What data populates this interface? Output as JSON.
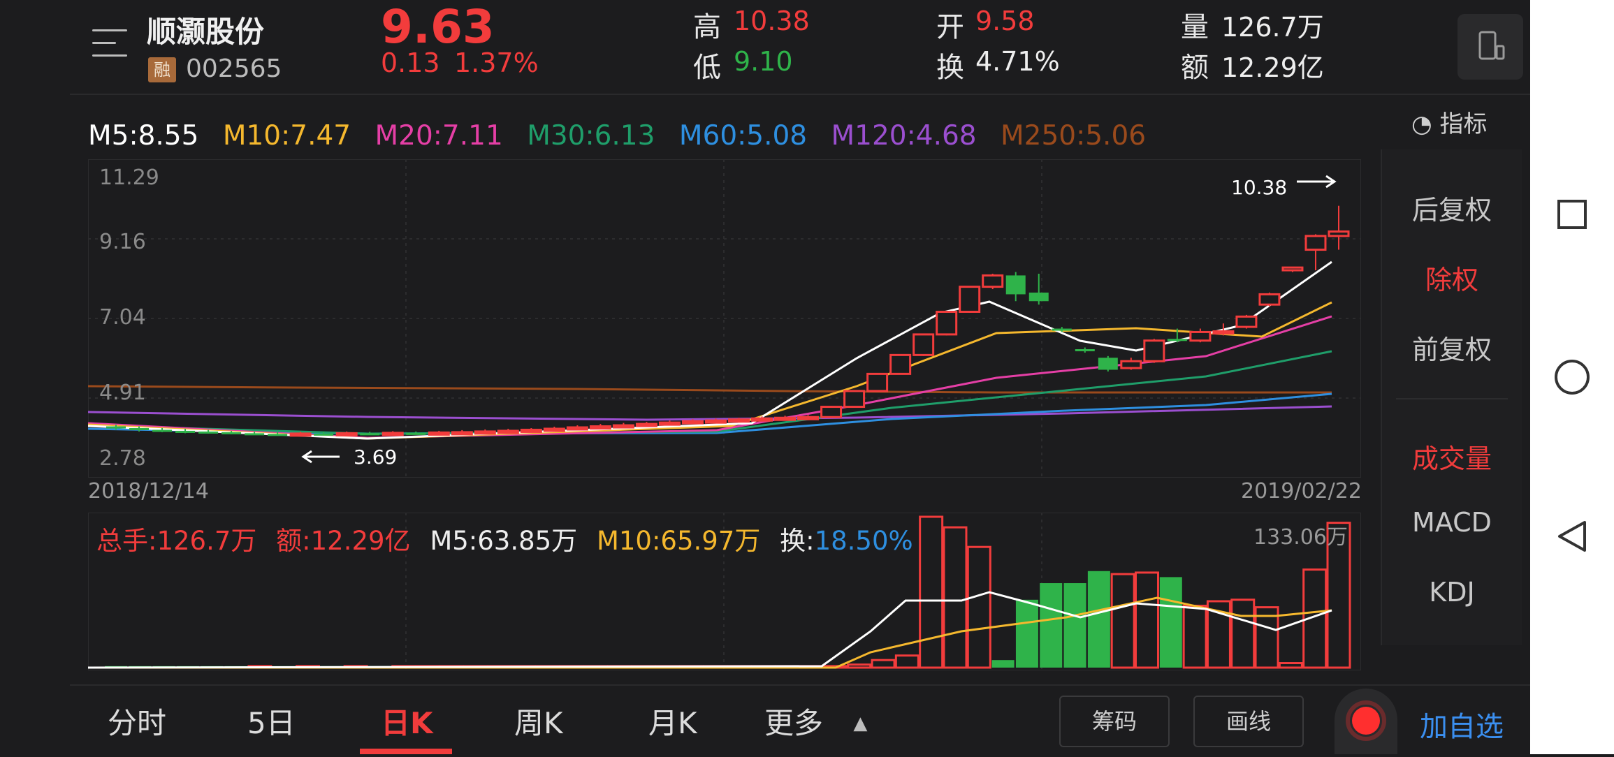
{
  "header": {
    "stock_name": "顺灏股份",
    "margin_badge": "融",
    "stock_code": "002565",
    "price": "9.63",
    "change": "0.13",
    "change_pct": "1.37%",
    "high_label": "高",
    "high": "10.38",
    "low_label": "低",
    "low": "9.10",
    "open_label": "开",
    "open": "9.58",
    "turnover_label": "换",
    "turnover": "4.71%",
    "volume_label": "量",
    "volume": "126.7万",
    "amount_label": "额",
    "amount": "12.29亿"
  },
  "indicators": {
    "ma5": "M5:8.55",
    "ma10": "M10:7.47",
    "ma20": "M20:7.11",
    "ma30": "M30:6.13",
    "ma60": "M60:5.08",
    "ma120": "M120:4.68",
    "ma250": "M250:5.06",
    "indicator_button": "指标"
  },
  "colors": {
    "up": "#f23c3c",
    "down": "#2fb34a",
    "ma5": "#ffffff",
    "ma10": "#f5b82e",
    "ma20": "#e53fa6",
    "ma30": "#1f9e6a",
    "ma60": "#2e8fe0",
    "ma120": "#9b4fd0",
    "ma250": "#9a4a1c",
    "accent_blue": "#3b8ff0"
  },
  "chart": {
    "y_ticks": [
      "11.29",
      "9.16",
      "7.04",
      "4.91",
      "2.78"
    ],
    "date_start": "2018/12/14",
    "date_end": "2019/02/22",
    "max_marker": "10.38",
    "min_marker": "3.69"
  },
  "chart_data": {
    "type": "candlestick",
    "ylim": [
      2.78,
      11.29
    ],
    "dates": [
      "2018/12/14",
      "2019/02/22"
    ],
    "candles": [
      [
        3.95,
        3.9,
        4.0,
        3.85
      ],
      [
        3.9,
        3.85,
        3.95,
        3.8
      ],
      [
        3.85,
        3.82,
        3.9,
        3.78
      ],
      [
        3.82,
        3.8,
        3.88,
        3.75
      ],
      [
        3.8,
        3.78,
        3.85,
        3.74
      ],
      [
        3.78,
        3.75,
        3.82,
        3.72
      ],
      [
        3.75,
        3.73,
        3.8,
        3.7
      ],
      [
        3.73,
        3.72,
        3.78,
        3.69
      ],
      [
        3.72,
        3.74,
        3.79,
        3.7
      ],
      [
        3.74,
        3.73,
        3.78,
        3.71
      ],
      [
        3.73,
        3.75,
        3.8,
        3.72
      ],
      [
        3.75,
        3.74,
        3.79,
        3.72
      ],
      [
        3.74,
        3.76,
        3.81,
        3.73
      ],
      [
        3.76,
        3.75,
        3.8,
        3.73
      ],
      [
        3.75,
        3.77,
        3.82,
        3.74
      ],
      [
        3.77,
        3.78,
        3.84,
        3.75
      ],
      [
        3.78,
        3.8,
        3.86,
        3.76
      ],
      [
        3.8,
        3.82,
        3.88,
        3.78
      ],
      [
        3.82,
        3.85,
        3.9,
        3.8
      ],
      [
        3.85,
        3.88,
        3.94,
        3.83
      ],
      [
        3.88,
        3.92,
        3.98,
        3.86
      ],
      [
        3.92,
        3.95,
        4.02,
        3.9
      ],
      [
        3.95,
        3.98,
        4.05,
        3.92
      ],
      [
        3.98,
        4.02,
        4.08,
        3.95
      ],
      [
        4.02,
        4.06,
        4.12,
        4.0
      ],
      [
        4.06,
        4.1,
        4.16,
        4.04
      ],
      [
        4.1,
        4.12,
        4.18,
        4.08
      ],
      [
        4.12,
        4.15,
        4.2,
        4.1
      ],
      [
        4.15,
        4.18,
        4.24,
        4.12
      ],
      [
        4.18,
        4.2,
        4.26,
        4.16
      ],
      [
        4.2,
        4.22,
        4.28,
        4.18
      ],
      [
        4.22,
        4.52,
        4.55,
        4.2
      ],
      [
        4.52,
        4.98,
        4.98,
        4.5
      ],
      [
        4.98,
        5.48,
        5.48,
        4.96
      ],
      [
        5.48,
        6.03,
        6.03,
        5.46
      ],
      [
        6.03,
        6.63,
        6.63,
        6.0
      ],
      [
        6.63,
        7.29,
        7.29,
        6.6
      ],
      [
        7.29,
        8.02,
        8.02,
        7.26
      ],
      [
        8.02,
        8.35,
        8.4,
        7.95
      ],
      [
        8.35,
        7.8,
        8.45,
        7.6
      ],
      [
        7.85,
        7.6,
        8.4,
        7.5
      ],
      [
        6.8,
        6.75,
        6.85,
        6.7
      ],
      [
        6.2,
        6.15,
        6.25,
        6.1
      ],
      [
        5.95,
        5.6,
        6.0,
        5.55
      ],
      [
        5.65,
        5.85,
        5.95,
        5.6
      ],
      [
        5.85,
        6.45,
        6.5,
        5.8
      ],
      [
        6.5,
        6.45,
        6.8,
        6.4
      ],
      [
        6.45,
        6.7,
        6.8,
        6.4
      ],
      [
        6.7,
        6.72,
        6.95,
        6.6
      ],
      [
        6.85,
        7.15,
        7.2,
        6.8
      ],
      [
        7.5,
        7.8,
        7.85,
        7.45
      ],
      [
        8.5,
        8.58,
        8.6,
        8.45
      ],
      [
        9.1,
        9.5,
        9.55,
        8.5
      ],
      [
        9.5,
        9.63,
        10.38,
        9.1
      ]
    ],
    "volume_max": "133.06万",
    "volumes_rel": [
      0.01,
      0.01,
      0.01,
      0.01,
      0.01,
      0.01,
      0.01,
      0.01,
      0.01,
      0.01,
      0.01,
      0.01,
      0.01,
      0.01,
      0.01,
      0.01,
      0.01,
      0.01,
      0.01,
      0.01,
      0.01,
      0.01,
      0.01,
      0.01,
      0.01,
      0.01,
      0.01,
      0.01,
      0.01,
      0.01,
      0.01,
      0.02,
      0.05,
      0.08,
      1.0,
      0.93,
      0.8,
      0.05,
      0.45,
      0.56,
      0.56,
      0.64,
      0.62,
      0.63,
      0.6,
      0.41,
      0.44,
      0.45,
      0.4,
      0.03,
      0.65,
      0.96
    ]
  },
  "volume": {
    "total": "总手:126.7万",
    "amount": "额:12.29亿",
    "ma5": "M5:63.85万",
    "ma10": "M10:65.97万",
    "turnover_label": "换:",
    "turnover": "18.50%"
  },
  "right_panel": {
    "adj_after": "后复权",
    "adj_none": "除权",
    "adj_before": "前复权",
    "volume": "成交量",
    "macd": "MACD",
    "kdj": "KDJ"
  },
  "tabs": {
    "minute": "分时",
    "five_day": "5日",
    "day_k": "日K",
    "week_k": "周K",
    "month_k": "月K",
    "more": "更多",
    "chips": "筹码",
    "draw": "画线",
    "add_watch": "加自选"
  }
}
